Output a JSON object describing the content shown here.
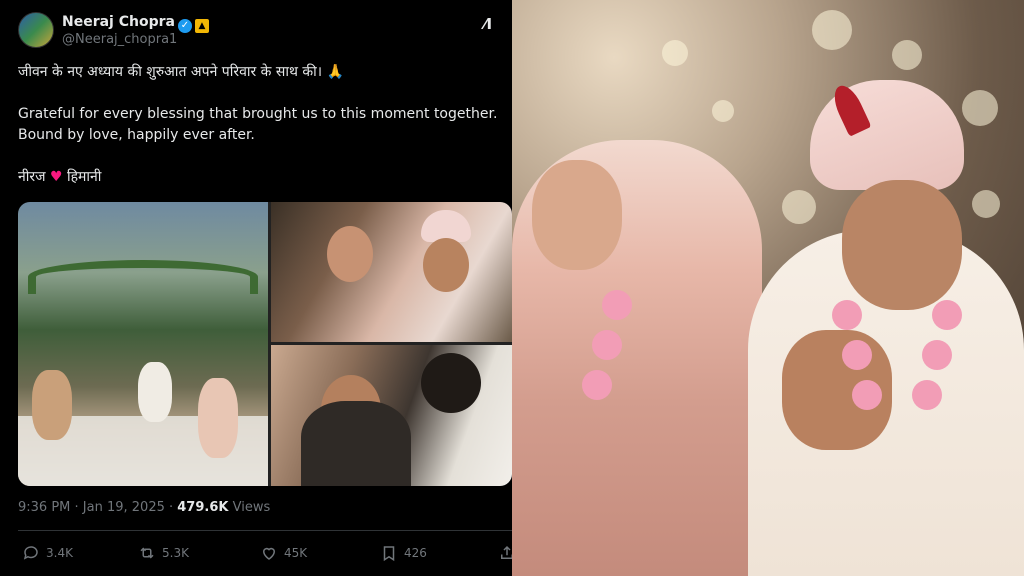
{
  "author": {
    "name": "Neeraj Chopra",
    "handle": "@Neeraj_chopra1"
  },
  "tweet": {
    "line1": "जीवन के नए अध्याय की शुरुआत अपने परिवार के साथ की। 🙏",
    "line2a": "Grateful for every blessing that brought us to this moment together.",
    "line2b": "Bound by love, happily ever after.",
    "sign_left": "नीरज",
    "sign_heart": "♥",
    "sign_right": "हिमानी"
  },
  "meta": {
    "time": "9:36 PM",
    "date": "Jan 19, 2025",
    "views_count": "479.6K",
    "views_label": "Views"
  },
  "actions": {
    "replies": "3.4K",
    "reposts": "5.3K",
    "likes": "45K",
    "bookmarks": "426"
  },
  "colors": {
    "background": "#000000",
    "text": "#e7e9ea",
    "muted": "#71767b",
    "verified": "#1d9bf0",
    "heart": "#f91880"
  },
  "icons": [
    "verified-icon",
    "grok-icon",
    "reply-icon",
    "repost-icon",
    "like-icon",
    "bookmark-icon",
    "share-icon"
  ]
}
